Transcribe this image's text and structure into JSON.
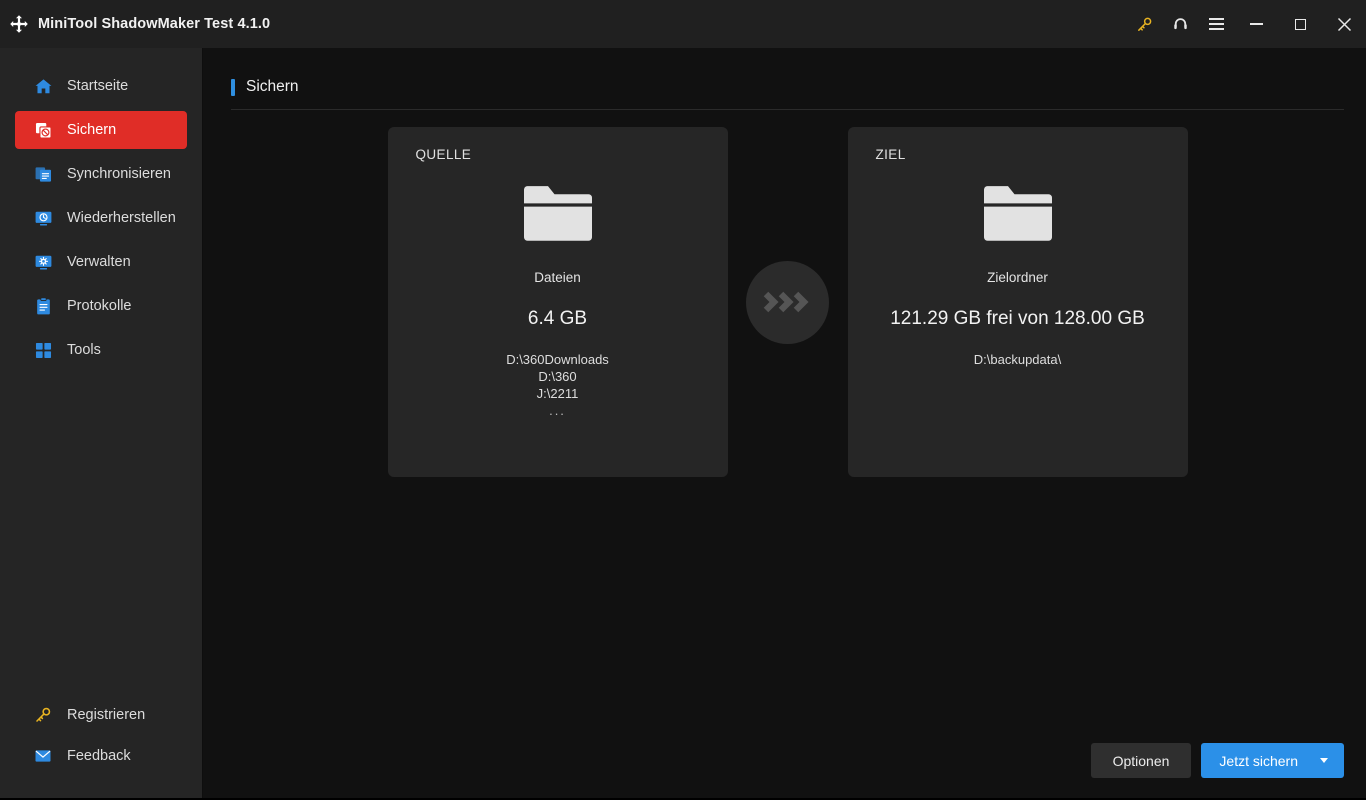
{
  "window": {
    "title": "MiniTool ShadowMaker Test 4.1.0",
    "logo_icon": "sync-arrows-icon",
    "controls": {
      "key": "key-icon",
      "support": "headset-icon",
      "menu": "hamburger-menu-icon",
      "minimize": "minimize-icon",
      "maximize": "maximize-icon",
      "close": "close-icon"
    }
  },
  "colors": {
    "accent_blue": "#2f8fe0",
    "primary_button": "#2b90e8",
    "active_nav": "#e02d27",
    "key_gold": "#e8b321",
    "icon_blue": "#2e8ae0",
    "card_bg": "#262626",
    "sidebar_bg": "#252525",
    "main_bg": "#111111",
    "titlebar_bg": "#202020"
  },
  "sidebar": {
    "items": [
      {
        "label": "Startseite",
        "icon": "home-icon",
        "active": false
      },
      {
        "label": "Sichern",
        "icon": "backup-icon",
        "active": true
      },
      {
        "label": "Synchronisieren",
        "icon": "sync-icon",
        "active": false
      },
      {
        "label": "Wiederherstellen",
        "icon": "restore-icon",
        "active": false
      },
      {
        "label": "Verwalten",
        "icon": "manage-icon",
        "active": false
      },
      {
        "label": "Protokolle",
        "icon": "logs-icon",
        "active": false
      },
      {
        "label": "Tools",
        "icon": "tools-icon",
        "active": false
      }
    ],
    "bottom_items": [
      {
        "label": "Registrieren",
        "icon": "key-icon"
      },
      {
        "label": "Feedback",
        "icon": "mail-icon"
      }
    ]
  },
  "page": {
    "title": "Sichern"
  },
  "source_card": {
    "label": "QUELLE",
    "icon": "folder-icon",
    "type": "Dateien",
    "size": "6.4 GB",
    "paths": [
      "D:\\360Downloads",
      "D:\\360",
      "J:\\2211"
    ],
    "more": "..."
  },
  "transfer_arrow": {
    "icon": "triple-chevron-right-icon"
  },
  "destination_card": {
    "label": "ZIEL",
    "icon": "folder-icon",
    "type": "Zielordner",
    "capacity": "121.29 GB frei von 128.00 GB",
    "path": "D:\\backupdata\\"
  },
  "footer": {
    "options_label": "Optionen",
    "backup_now_label": "Jetzt sichern",
    "dropdown_icon": "caret-down-icon"
  }
}
